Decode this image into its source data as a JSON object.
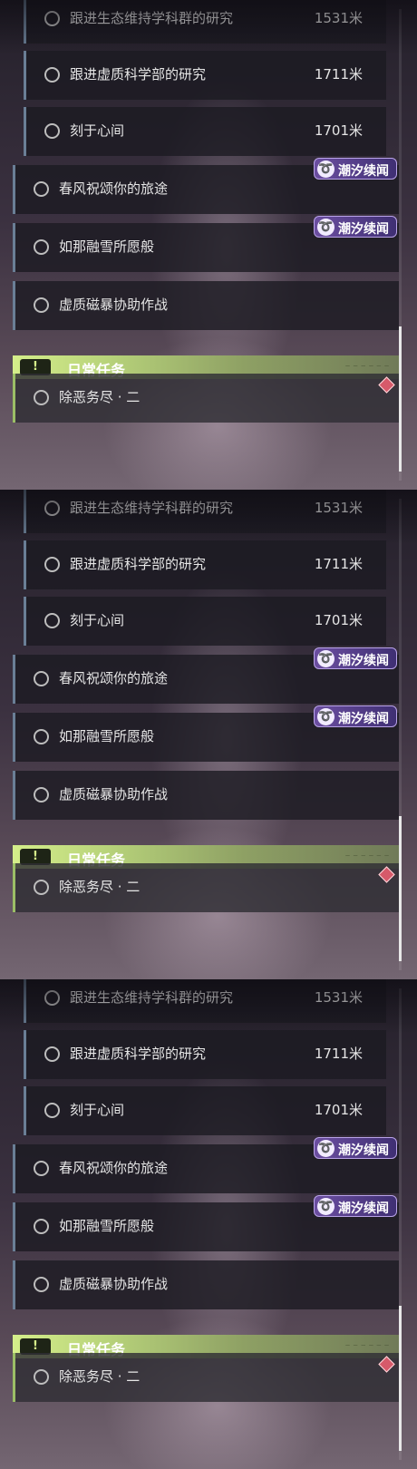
{
  "sub_quests": [
    {
      "label": "跟进生态维持学科群的研究",
      "distance": "1531米"
    },
    {
      "label": "跟进虚质科学部的研究",
      "distance": "1711米"
    },
    {
      "label": "刻于心间",
      "distance": "1701米"
    }
  ],
  "main_quests": [
    {
      "label": "春风祝颂你的旅途",
      "badge": "潮汐续闻",
      "badge_icon": "tide-swirl-icon"
    },
    {
      "label": "如那融雪所愿般",
      "badge": "潮汐续闻",
      "badge_icon": "tide-swirl-icon"
    },
    {
      "label": "虚质磁暴协助作战",
      "badge": ""
    }
  ],
  "daily_section": {
    "title": "日常任务",
    "icon": "exclamation-mark",
    "icon_glyph": "!",
    "items": [
      {
        "label": "除恶务尽 · 二"
      }
    ]
  },
  "colors": {
    "sub_accent": "#6a7f96",
    "daily_accent": "#9bbf66",
    "badge": "#5a3f8c",
    "header": "#c8e07e",
    "alert": "#d65a6a"
  }
}
